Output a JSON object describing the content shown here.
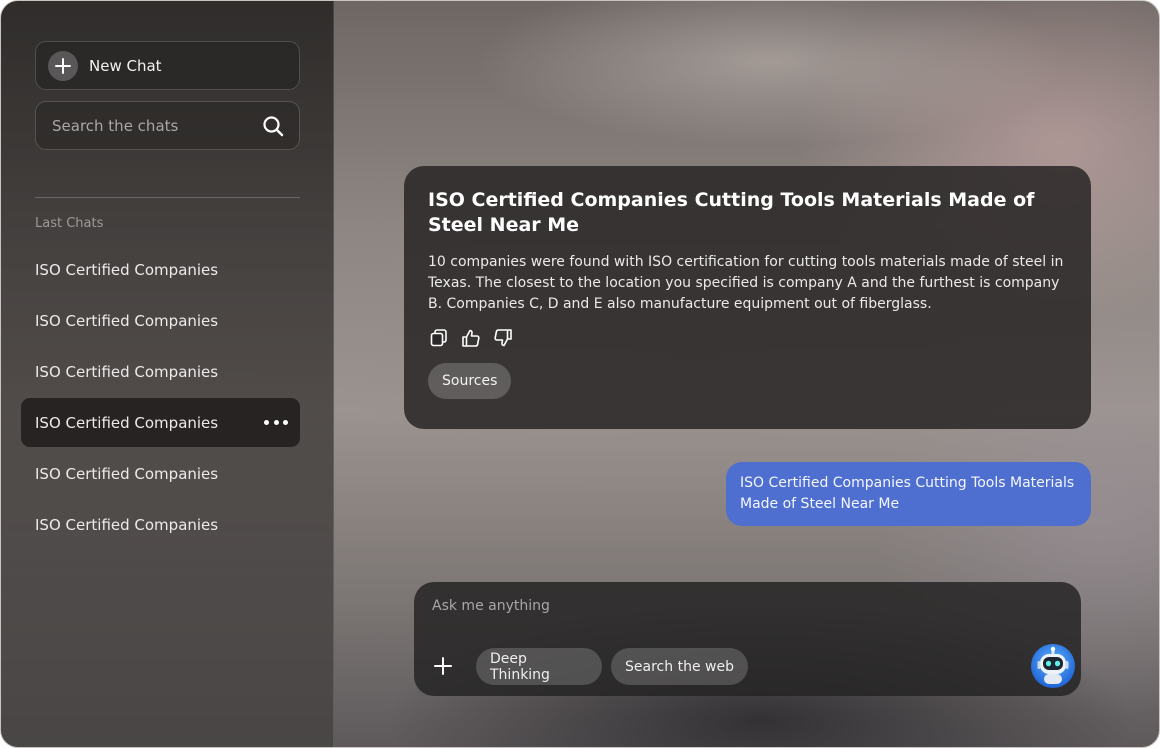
{
  "sidebar": {
    "new_chat_label": "New Chat",
    "search_placeholder": "Search the chats",
    "section_label": "Last Chats",
    "chats": [
      {
        "label": "ISO Certified Companies"
      },
      {
        "label": "ISO Certified Companies"
      },
      {
        "label": "ISO Certified Companies"
      },
      {
        "label": "ISO Certified Companies",
        "active": true
      },
      {
        "label": "ISO Certified Companies"
      },
      {
        "label": "ISO Certified Companies"
      }
    ]
  },
  "answer": {
    "title": "ISO Certified Companies Cutting Tools Materials Made of Steel Near Me",
    "body": "10 companies were found with ISO certification for cutting tools materials made of steel in Texas. The closest to the location you specified is company A and the furthest is company B. Companies C, D and E also manufacture equipment out of fiberglass.",
    "actions": [
      "copy-icon",
      "thumbs-up-icon",
      "thumbs-down-icon"
    ],
    "sources_label": "Sources"
  },
  "user_message": {
    "text": "ISO Certified Companies Cutting Tools Materials Made of Steel Near Me"
  },
  "composer": {
    "placeholder": "Ask me anything",
    "deep_thinking_label": "Deep Thinking",
    "search_web_label": "Search the web"
  },
  "colors": {
    "accent_blue": "#4e6fd0",
    "card_dark": "#232121"
  }
}
